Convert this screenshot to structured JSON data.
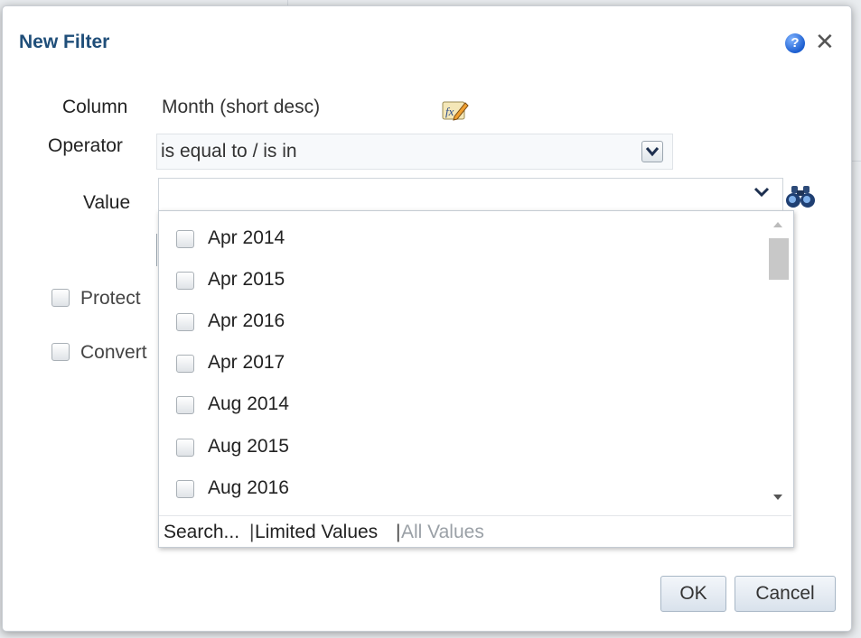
{
  "dialog": {
    "title": "New Filter",
    "help_icon": "?",
    "close_icon": "✕"
  },
  "form": {
    "column_label": "Column",
    "column_value": "Month (short desc)",
    "operator_label": "Operator",
    "operator_value": "is equal to / is in",
    "value_label": "Value",
    "value_text": "",
    "protect_label": "Protect",
    "convert_label": "Convert"
  },
  "dropdown": {
    "items": [
      {
        "label": "Apr 2014",
        "checked": false
      },
      {
        "label": "Apr 2015",
        "checked": false
      },
      {
        "label": "Apr 2016",
        "checked": false
      },
      {
        "label": "Apr 2017",
        "checked": false
      },
      {
        "label": "Aug 2014",
        "checked": false
      },
      {
        "label": "Aug 2015",
        "checked": false
      },
      {
        "label": "Aug 2016",
        "checked": false
      }
    ],
    "footer": {
      "search": "Search...",
      "separator": "|",
      "limited": "Limited Values",
      "all": "All Values"
    }
  },
  "buttons": {
    "ok": "OK",
    "cancel": "Cancel"
  },
  "colors": {
    "title": "#1f4e79",
    "help_icon": "#1d5fd0"
  }
}
